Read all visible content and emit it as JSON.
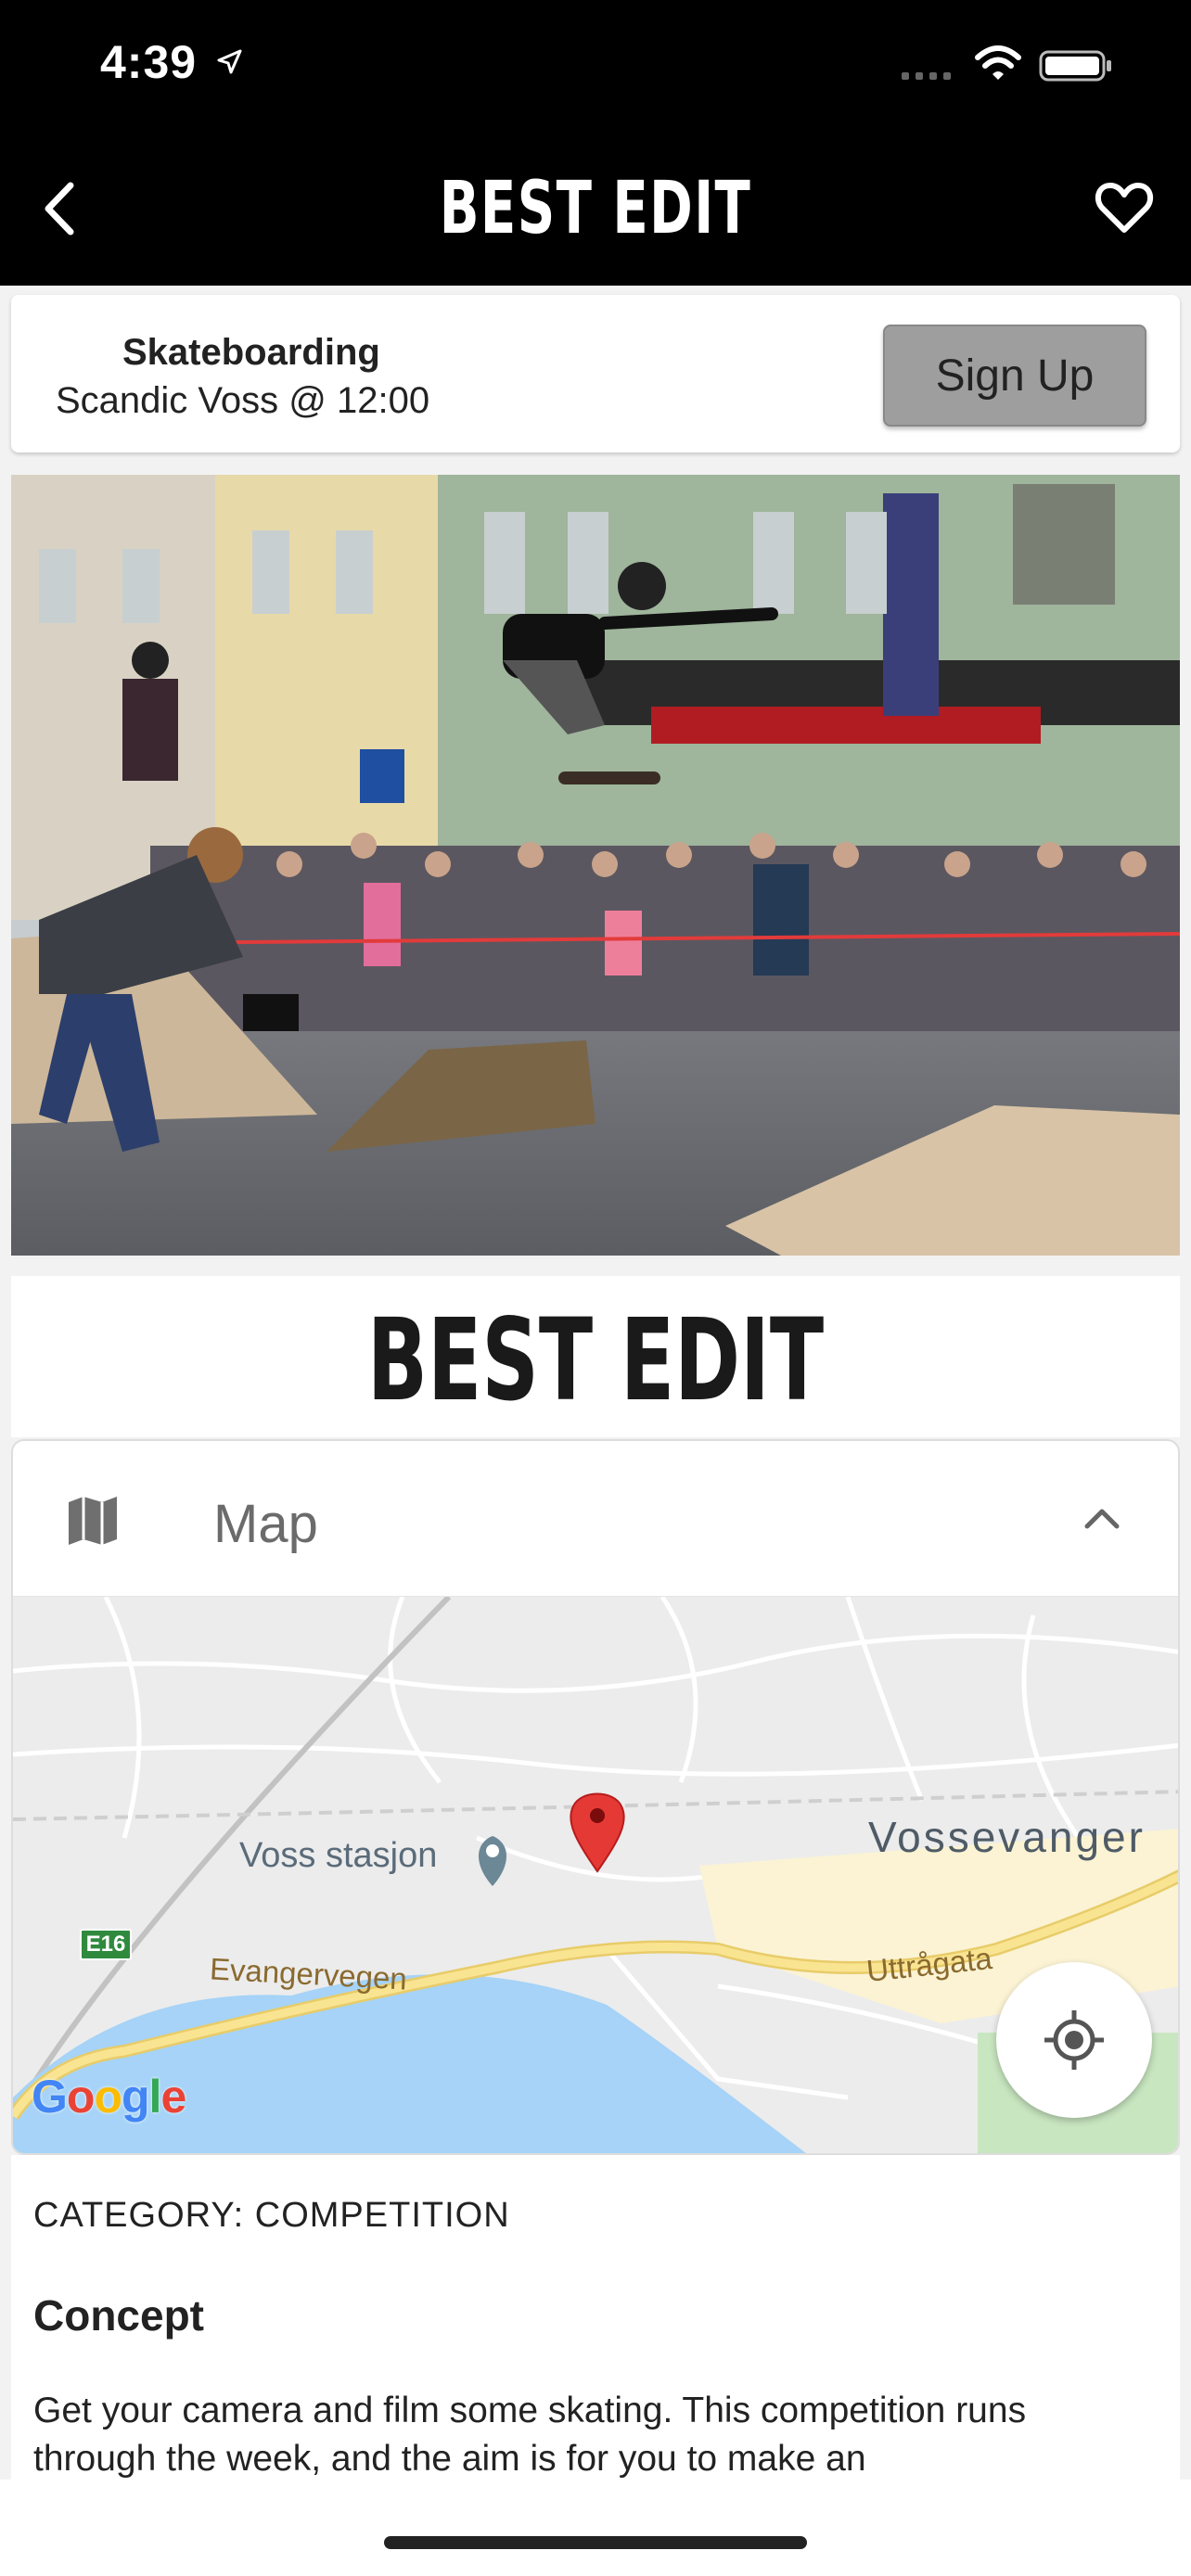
{
  "status_bar": {
    "time": "4:39"
  },
  "nav": {
    "title": "BEST EDIT"
  },
  "event": {
    "name": "Skateboarding",
    "venue_time": "Scandic Voss @ 12:00",
    "signup_label": "Sign Up"
  },
  "main_title": "BEST EDIT",
  "map": {
    "header_label": "Map",
    "labels": {
      "station": "Voss stasjon",
      "town": "Vossevanger",
      "road1": "Evangervegen",
      "road2": "Uttrågata",
      "route": "E16",
      "provider": "Google"
    },
    "colors": {
      "water": "#a6d3f7",
      "road": "#f7e08a",
      "land": "#eeeeee",
      "pin": "#e53935"
    }
  },
  "details": {
    "category": "CATEGORY: COMPETITION",
    "heading": "Concept",
    "body": "Get your camera and film some skating. This competition runs through the week, and the aim is for you to make an"
  },
  "icons": [
    "location-arrow-icon",
    "signal-icon",
    "wifi-icon",
    "battery-icon",
    "back-icon",
    "heart-icon",
    "map-icon",
    "chevron-up-icon",
    "map-pin-icon",
    "station-pin-icon",
    "my-location-icon"
  ]
}
